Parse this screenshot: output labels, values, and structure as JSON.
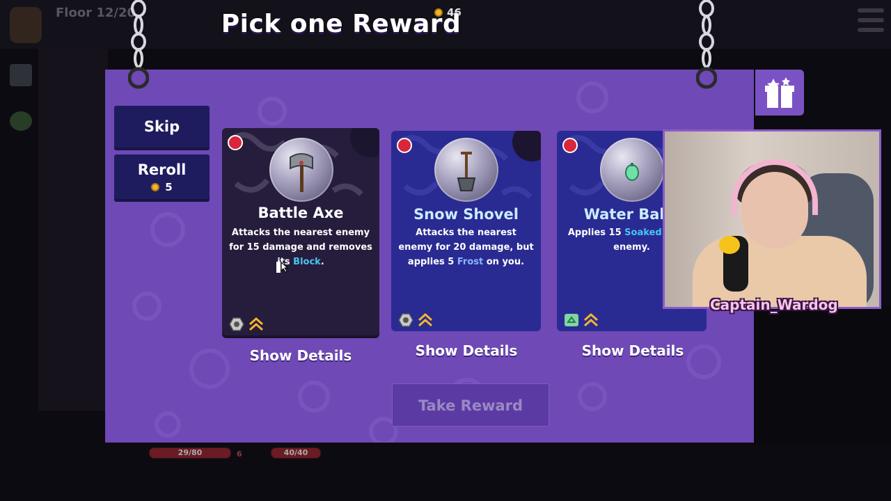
{
  "hud": {
    "floor": "Floor 12/20",
    "gold": "46",
    "health_bar": "29/80",
    "health_extra": "6",
    "enemy_bar": "40/40"
  },
  "modal": {
    "title": "Pick one Reward",
    "skip_label": "Skip",
    "reroll_label": "Reroll",
    "reroll_cost": "5",
    "take_reward_label": "Take Reward",
    "take_reward_enabled": false
  },
  "cards": [
    {
      "name": "Battle Axe",
      "icon": "battle-axe-icon",
      "desc_pre": "Attacks the nearest enemy for 15 damage and removes its ",
      "desc_kw": "Block",
      "desc_post": ".",
      "details_label": "Show Details",
      "selected": true
    },
    {
      "name": "Snow Shovel",
      "icon": "snow-shovel-icon",
      "desc_pre": "Attacks the nearest enemy for 20 damage, but applies 5 ",
      "desc_kw": "Frost",
      "desc_post": " on you.",
      "details_label": "Show Details",
      "selected": false
    },
    {
      "name": "Water Ballo",
      "icon": "water-balloon-icon",
      "desc_pre": "Applies 15 ",
      "desc_kw": "Soaked",
      "desc_post": " to the enemy.",
      "details_label": "Show Details",
      "selected": false
    }
  ],
  "stream": {
    "streamer_name": "Captain_Wardog"
  },
  "colors": {
    "modal_bg": "#6f49b6",
    "button_bg": "#1e1c5e",
    "card_bg": "#2a2a93",
    "selected_card_bg": "#261c3c",
    "keyword": "#45c6f0",
    "rarity_red": "#d8263b",
    "gold": "#f0b428"
  }
}
